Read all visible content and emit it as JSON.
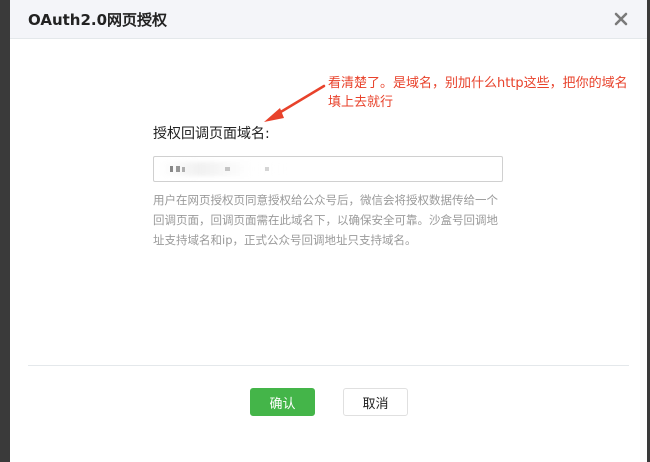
{
  "dialog": {
    "title": "OAuth2.0网页授权",
    "close_icon": "close-icon"
  },
  "annotation": {
    "line1": "看清楚了。是域名，别加什么http这些，把你的域名",
    "line2": "填上去就行",
    "color": "#e8422b"
  },
  "form": {
    "label": "授权回调页面域名:",
    "input_value": "",
    "help_text": "用户在网页授权页同意授权给公众号后，微信会将授权数据传给一个回调页面，回调页面需在此域名下，以确保安全可靠。沙盒号回调地址支持域名和ip，正式公众号回调地址只支持域名。"
  },
  "footer": {
    "confirm_label": "确认",
    "cancel_label": "取消",
    "confirm_color": "#44b549"
  }
}
